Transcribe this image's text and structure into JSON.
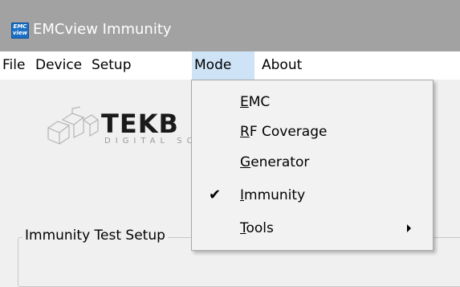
{
  "window": {
    "title": "EMCview Immunity",
    "icon": {
      "top": "EMC",
      "bottom": "view"
    }
  },
  "menubar": {
    "items": [
      {
        "key": "file",
        "label": "File"
      },
      {
        "key": "device",
        "label": "Device"
      },
      {
        "key": "setup",
        "label": "Setup"
      },
      {
        "key": "mode",
        "label": "Mode",
        "active": true
      },
      {
        "key": "about",
        "label": "About"
      }
    ]
  },
  "logo": {
    "text": "TEKB",
    "subtext": "DIGITAL SC"
  },
  "group": {
    "label": "Immunity Test Setup"
  },
  "mode_menu": {
    "items": [
      {
        "key": "emc",
        "mnemonic": "E",
        "rest": "MC",
        "checked": false,
        "submenu": false
      },
      {
        "key": "rf-coverage",
        "mnemonic": "R",
        "rest": "F Coverage",
        "checked": false,
        "submenu": false
      },
      {
        "key": "generator",
        "mnemonic": "G",
        "rest": "enerator",
        "checked": false,
        "submenu": false
      },
      {
        "key": "immunity",
        "mnemonic": "I",
        "rest": "mmunity",
        "checked": true,
        "submenu": false,
        "check_glyph": "✔"
      },
      {
        "key": "tools",
        "mnemonic": "T",
        "rest": "ools",
        "checked": false,
        "submenu": true
      }
    ]
  },
  "colors": {
    "titlebar": "#a2a2a2",
    "menubar": "#ffffff",
    "menu_active": "#cfe3f7",
    "dropdown_bg": "#f2f2f2",
    "body_bg": "#f0f0f0"
  }
}
